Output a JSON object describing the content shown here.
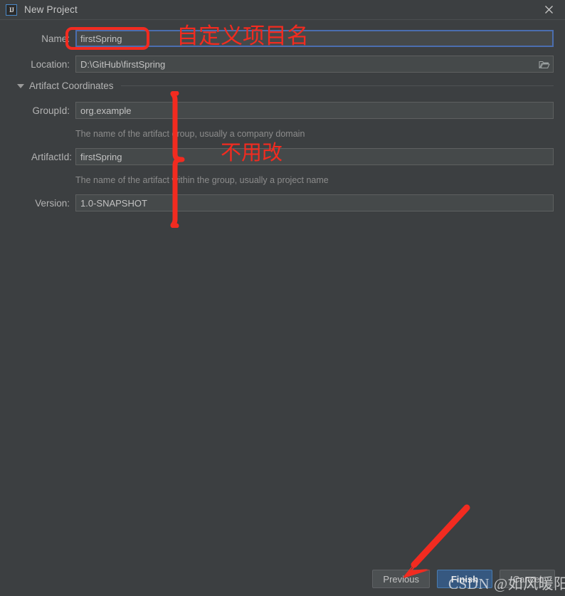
{
  "window": {
    "title": "New Project",
    "icon": "intellij-idea-icon",
    "close_icon": "close-icon"
  },
  "form": {
    "name": {
      "label": "Name:",
      "value": "firstSpring",
      "focused": true
    },
    "location": {
      "label": "Location:",
      "value": "D:\\GitHub\\firstSpring",
      "browse_icon": "folder-icon"
    },
    "artifact_section": {
      "title": "Artifact Coordinates",
      "expanded": true,
      "triangle_icon": "chevron-down-icon"
    },
    "group_id": {
      "label": "GroupId:",
      "value": "org.example",
      "hint": "The name of the artifact group, usually a company domain"
    },
    "artifact_id": {
      "label": "ArtifactId:",
      "value": "firstSpring",
      "hint": "The name of the artifact within the group, usually a project name"
    },
    "version": {
      "label": "Version:",
      "value": "1.0-SNAPSHOT"
    }
  },
  "buttons": {
    "previous": "Previous",
    "finish": "Finish",
    "cancel": "Cancel"
  },
  "annotations": {
    "name_note": "自定义项目名",
    "no_edit_note": "不用改",
    "arrow_icon": "red-arrow-icon",
    "brace_icon": "red-brace-icon",
    "box_icon": "red-highlight-box"
  },
  "watermark": "CSDN @如风暖阳",
  "colors": {
    "dialog_bg": "#3c3f41",
    "field_bg": "#45494a",
    "accent_blue": "#365880",
    "focus_blue": "#4b6eaf",
    "annotation_red": "#f22b20",
    "text": "#b4b4b4",
    "hint_text": "#8c8c8c"
  }
}
